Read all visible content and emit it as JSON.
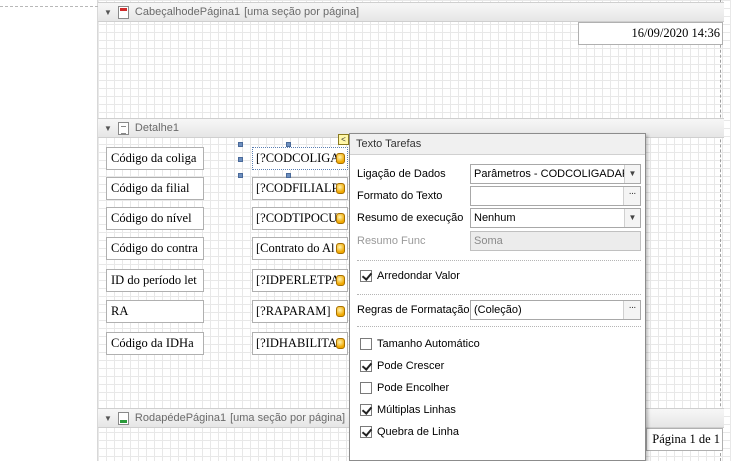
{
  "page_header": {
    "band_title": "CabeçalhodePágina1",
    "band_note": "[uma seção por página]",
    "date_text": "16/09/2020 14:36"
  },
  "detail": {
    "band_title": "Detalhe1",
    "rows": [
      {
        "label": "Código da coliga",
        "field": "[?CODCOLIGA"
      },
      {
        "label": "Código da filial",
        "field": "[?CODFILIALP"
      },
      {
        "label": "Código do nível",
        "field": "[?CODTIPOCU"
      },
      {
        "label": "Código do contra",
        "field": "[Contrato do Al"
      },
      {
        "label": "ID do período let",
        "field": "[?IDPERLETPA"
      },
      {
        "label": "RA",
        "field": "[?RAPARAM]"
      },
      {
        "label": "Código da IDHa",
        "field": "[?IDHABILITA"
      }
    ]
  },
  "page_footer": {
    "band_title": "RodapédePágina1",
    "band_note": "[uma seção por página]",
    "page_text": "Página 1 de 1"
  },
  "smart_tag": {
    "button_glyph": "<",
    "title": "Texto Tarefas",
    "data_binding_label": "Ligação de Dados",
    "data_binding_value": "Parâmetros - CODCOLIGADAP",
    "format_string_label": "Formato do Texto",
    "format_string_value": "",
    "summary_label": "Resumo de execução",
    "summary_value": "Nenhum",
    "summary_func_label": "Resumo Func",
    "summary_func_value": "Soma",
    "round_value_label": "Arredondar Valor",
    "round_value_checked": true,
    "formatting_rules_label": "Regras de Formatação",
    "formatting_rules_value": "(Coleção)",
    "ellipsis": "···",
    "options": [
      {
        "label": "Tamanho Automático",
        "checked": false
      },
      {
        "label": "Pode Crescer",
        "checked": true
      },
      {
        "label": "Pode Encolher",
        "checked": false
      },
      {
        "label": "Múltiplas Linhas",
        "checked": true
      },
      {
        "label": "Quebra de Linha",
        "checked": true
      }
    ]
  }
}
